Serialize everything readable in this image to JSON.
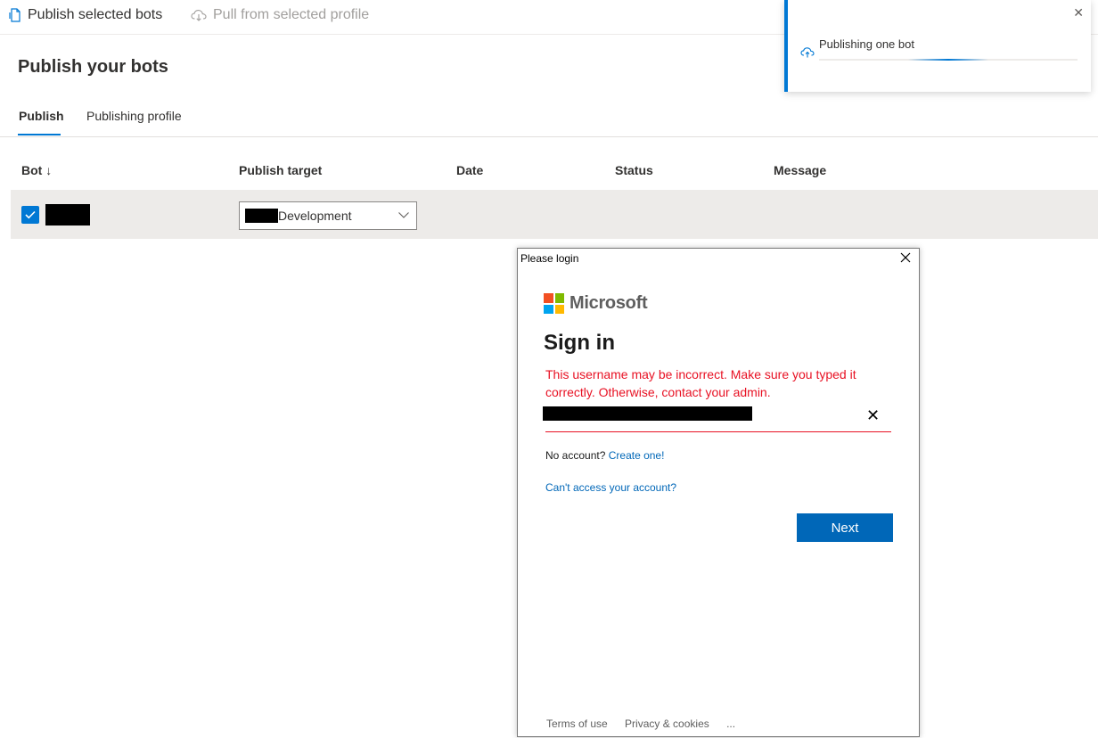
{
  "toolbar": {
    "publish_label": "Publish selected bots",
    "pull_label": "Pull from selected profile"
  },
  "page": {
    "title": "Publish your bots"
  },
  "tabs": [
    {
      "label": "Publish",
      "active": true
    },
    {
      "label": "Publishing profile",
      "active": false
    }
  ],
  "table": {
    "columns": [
      "Bot ↓",
      "Publish target",
      "Date",
      "Status",
      "Message"
    ],
    "rows": [
      {
        "checked": true,
        "bot": "",
        "target": "Development",
        "date": "",
        "status": "",
        "message": ""
      }
    ]
  },
  "toast": {
    "text": "Publishing one bot"
  },
  "login": {
    "window_title": "Please login",
    "brand": "Microsoft",
    "heading": "Sign in",
    "error": "This username may be incorrect. Make sure you typed it correctly. Otherwise, contact your admin.",
    "no_account": "No account?",
    "create_link": "Create one!",
    "cant_access": "Can't access your account?",
    "next_label": "Next",
    "footer_terms": "Terms of use",
    "footer_privacy": "Privacy & cookies",
    "footer_more": "..."
  },
  "colors": {
    "accent": "#0078d4",
    "ms_blue": "#0067b8",
    "error_red": "#e81123",
    "row_selected": "#edebe9"
  },
  "icons": {
    "publish": "document-icon",
    "pull": "cloud-download-icon",
    "toast": "cloud-upload-icon",
    "close": "close-icon",
    "chevron": "chevron-down-icon",
    "check": "check-icon"
  }
}
